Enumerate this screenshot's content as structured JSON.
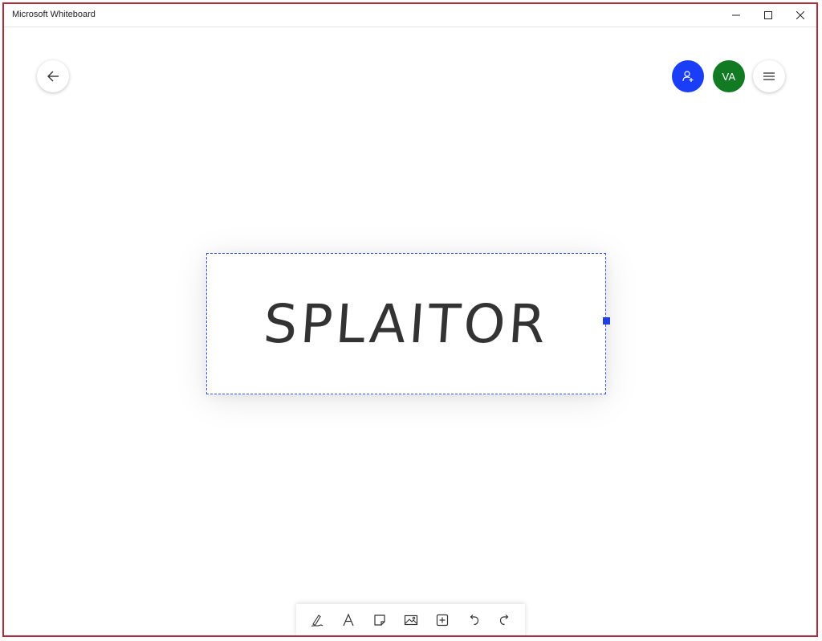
{
  "window": {
    "title": "Microsoft Whiteboard"
  },
  "colors": {
    "window_border": "#b3293a",
    "invite_button": "#1a3ef7",
    "avatar": "#117a22",
    "selection": "#3a55d8",
    "ink": "#333333"
  },
  "header": {
    "back_icon": "arrow-left-icon",
    "invite_icon": "person-add-icon",
    "avatar_initials": "VA",
    "menu_icon": "hamburger-menu-icon"
  },
  "canvas": {
    "note_text": "SPLAITOR"
  },
  "toolbar": {
    "tools": [
      {
        "name": "pen",
        "icon": "pen-icon"
      },
      {
        "name": "text",
        "icon": "text-icon"
      },
      {
        "name": "note",
        "icon": "sticky-note-icon"
      },
      {
        "name": "image",
        "icon": "image-icon"
      },
      {
        "name": "add",
        "icon": "add-box-icon"
      },
      {
        "name": "undo",
        "icon": "undo-icon"
      },
      {
        "name": "redo",
        "icon": "redo-icon"
      }
    ]
  }
}
